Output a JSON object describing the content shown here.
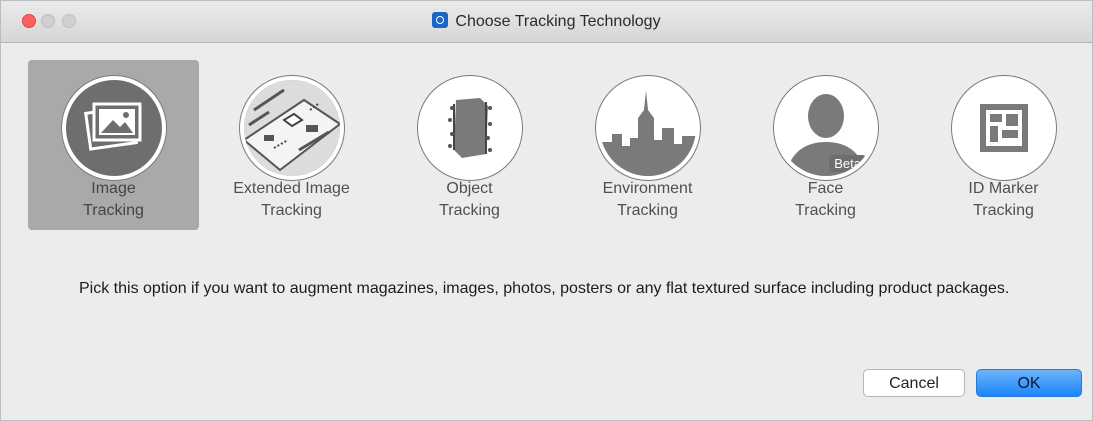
{
  "window": {
    "title": "Choose Tracking Technology",
    "app_icon": "vuforia-app-icon"
  },
  "options": [
    {
      "line1": "Image",
      "line2": "Tracking",
      "icon": "image-tracking-icon",
      "selected": true
    },
    {
      "line1": "Extended Image",
      "line2": "Tracking",
      "icon": "extended-image-tracking-icon",
      "selected": false
    },
    {
      "line1": "Object",
      "line2": "Tracking",
      "icon": "object-tracking-icon",
      "selected": false
    },
    {
      "line1": "Environment",
      "line2": "Tracking",
      "icon": "environment-tracking-icon",
      "selected": false
    },
    {
      "line1": "Face",
      "line2": "Tracking",
      "icon": "face-tracking-icon",
      "selected": false,
      "badge": "Beta"
    },
    {
      "line1": "ID Marker",
      "line2": "Tracking",
      "icon": "id-marker-tracking-icon",
      "selected": false
    }
  ],
  "description": "Pick this option if you want to augment magazines, images, photos, posters or any flat textured surface including product packages.",
  "buttons": {
    "cancel": "Cancel",
    "ok": "OK"
  },
  "colors": {
    "selected_background": "#a9a9a9",
    "icon_fill": "#6e6e6e",
    "ok_button": "#1b86f9",
    "close_button": "#fc605c"
  }
}
